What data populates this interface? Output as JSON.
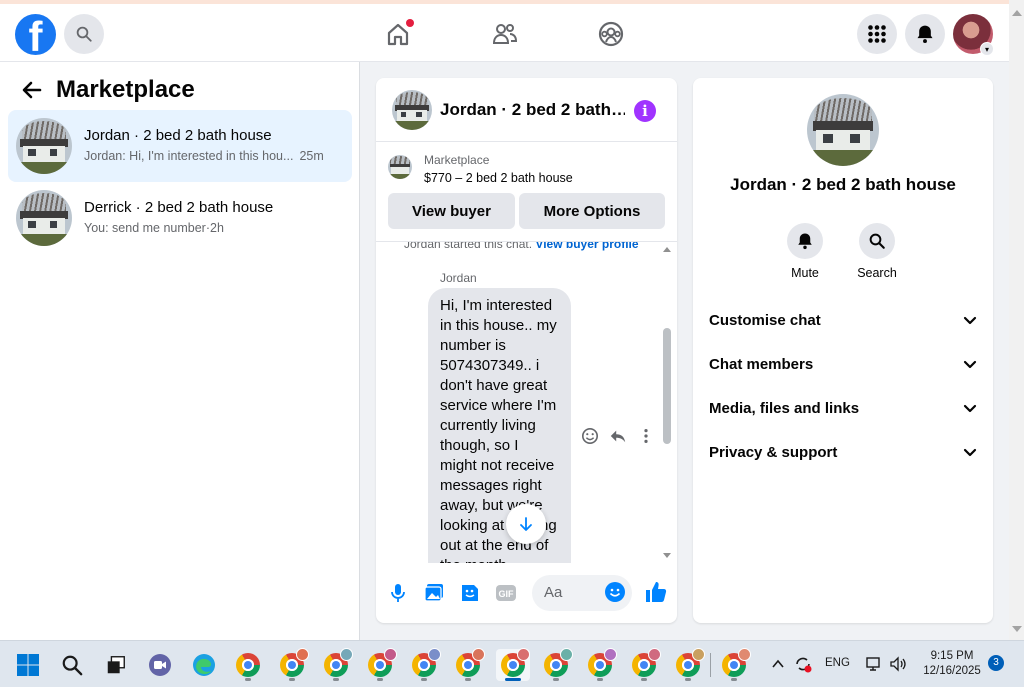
{
  "app": {
    "logo_letter": "f"
  },
  "left": {
    "title": "Marketplace",
    "conversations": [
      {
        "title": "Jordan · 2 bed 2 bath house",
        "preview": "Jordan: Hi, I'm interested in this hou...",
        "time": "25m",
        "active": true
      },
      {
        "title": "Derrick · 2 bed 2 bath house",
        "preview": "You: send me number",
        "time": "·2h",
        "active": false
      }
    ]
  },
  "chat": {
    "header_title": "Jordan · 2 bed 2 bath…",
    "listing_source": "Marketplace",
    "listing_price": "$770 – 2 bed 2 bath house",
    "view_buyer_label": "View buyer",
    "more_options_label": "More Options",
    "started_text": "Jordan started this chat.",
    "view_buyer_profile": "View buyer profile",
    "sender": "Jordan",
    "message": "Hi,  I'm interested in this house.. my number is 5074307349.. i don't have great service where I'm currently living though, so I might not receive messages right away,  but we're looking at moving out at the end of the month",
    "composer_placeholder": "Aa"
  },
  "details": {
    "title": "Jordan · 2 bed 2 bath house",
    "mute_label": "Mute",
    "search_label": "Search",
    "sections": [
      "Customise chat",
      "Chat members",
      "Media, files and links",
      "Privacy & support"
    ]
  },
  "taskbar": {
    "language": "ENG",
    "time": "9:15 PM",
    "date": "12/16/2025",
    "notifications": "3"
  },
  "colors": {
    "accent": "#1877f2",
    "messenger": "#0084ff",
    "info": "#a033ff",
    "badge": "#e41e3f"
  }
}
